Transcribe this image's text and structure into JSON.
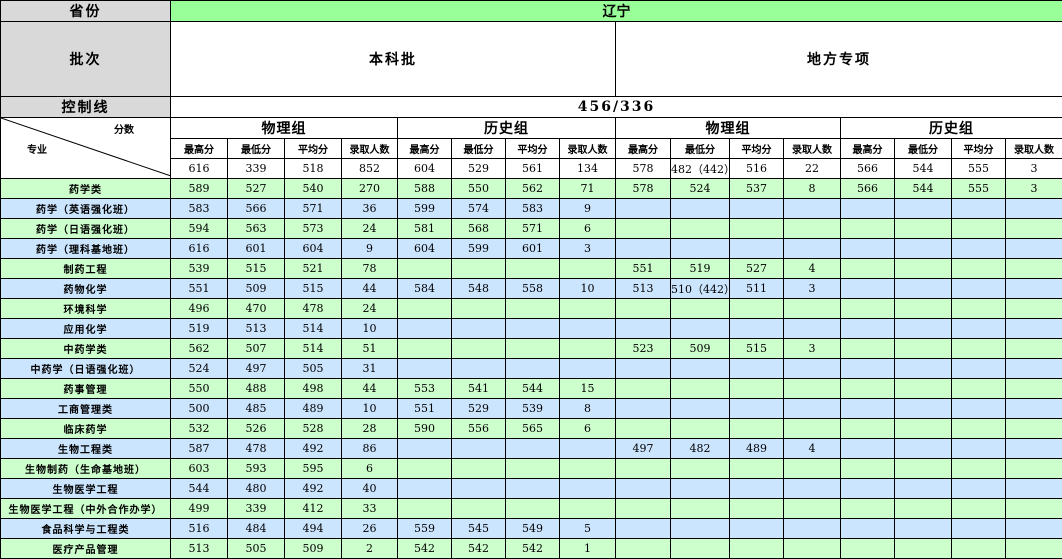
{
  "labels": {
    "province": "省份",
    "batch": "批次",
    "control_line": "控制线",
    "score_header": "分数",
    "major_header": "专业"
  },
  "province_value": "辽宁",
  "batches": [
    "本科批",
    "地方专项"
  ],
  "control_line_value": "456/336",
  "groups": [
    "物理组",
    "历史组",
    "物理组",
    "历史组"
  ],
  "stat_headers": [
    "最高分",
    "最低分",
    "平均分",
    "录取人数"
  ],
  "totals": [
    "616",
    "339",
    "518",
    "852",
    "604",
    "529",
    "561",
    "134",
    "578",
    "482（442）",
    "516",
    "22",
    "566",
    "544",
    "555",
    "3"
  ],
  "rows": [
    {
      "name": "药学类",
      "cells": [
        "589",
        "527",
        "540",
        "270",
        "588",
        "550",
        "562",
        "71",
        "578",
        "524",
        "537",
        "8",
        "566",
        "544",
        "555",
        "3"
      ]
    },
    {
      "name": "药学（英语强化班）",
      "cells": [
        "583",
        "566",
        "571",
        "36",
        "599",
        "574",
        "583",
        "9",
        "",
        "",
        "",
        "",
        "",
        "",
        "",
        ""
      ]
    },
    {
      "name": "药学（日语强化班）",
      "cells": [
        "594",
        "563",
        "573",
        "24",
        "581",
        "568",
        "571",
        "6",
        "",
        "",
        "",
        "",
        "",
        "",
        "",
        ""
      ]
    },
    {
      "name": "药学（理科基地班）",
      "cells": [
        "616",
        "601",
        "604",
        "9",
        "604",
        "599",
        "601",
        "3",
        "",
        "",
        "",
        "",
        "",
        "",
        "",
        ""
      ]
    },
    {
      "name": "制药工程",
      "cells": [
        "539",
        "515",
        "521",
        "78",
        "",
        "",
        "",
        "",
        "551",
        "519",
        "527",
        "4",
        "",
        "",
        "",
        ""
      ]
    },
    {
      "name": "药物化学",
      "cells": [
        "551",
        "509",
        "515",
        "44",
        "584",
        "548",
        "558",
        "10",
        "513",
        "510（442）",
        "511",
        "3",
        "",
        "",
        "",
        ""
      ]
    },
    {
      "name": "环境科学",
      "cells": [
        "496",
        "470",
        "478",
        "24",
        "",
        "",
        "",
        "",
        "",
        "",
        "",
        "",
        "",
        "",
        "",
        ""
      ]
    },
    {
      "name": "应用化学",
      "cells": [
        "519",
        "513",
        "514",
        "10",
        "",
        "",
        "",
        "",
        "",
        "",
        "",
        "",
        "",
        "",
        "",
        ""
      ]
    },
    {
      "name": "中药学类",
      "cells": [
        "562",
        "507",
        "514",
        "51",
        "",
        "",
        "",
        "",
        "523",
        "509",
        "515",
        "3",
        "",
        "",
        "",
        ""
      ]
    },
    {
      "name": "中药学（日语强化班）",
      "cells": [
        "524",
        "497",
        "505",
        "31",
        "",
        "",
        "",
        "",
        "",
        "",
        "",
        "",
        "",
        "",
        "",
        ""
      ]
    },
    {
      "name": "药事管理",
      "cells": [
        "550",
        "488",
        "498",
        "44",
        "553",
        "541",
        "544",
        "15",
        "",
        "",
        "",
        "",
        "",
        "",
        "",
        ""
      ]
    },
    {
      "name": "工商管理类",
      "cells": [
        "500",
        "485",
        "489",
        "10",
        "551",
        "529",
        "539",
        "8",
        "",
        "",
        "",
        "",
        "",
        "",
        "",
        ""
      ]
    },
    {
      "name": "临床药学",
      "cells": [
        "532",
        "526",
        "528",
        "28",
        "590",
        "556",
        "565",
        "6",
        "",
        "",
        "",
        "",
        "",
        "",
        "",
        ""
      ]
    },
    {
      "name": "生物工程类",
      "cells": [
        "587",
        "478",
        "492",
        "86",
        "",
        "",
        "",
        "",
        "497",
        "482",
        "489",
        "4",
        "",
        "",
        "",
        ""
      ]
    },
    {
      "name": "生物制药（生命基地班）",
      "cells": [
        "603",
        "593",
        "595",
        "6",
        "",
        "",
        "",
        "",
        "",
        "",
        "",
        "",
        "",
        "",
        "",
        ""
      ]
    },
    {
      "name": "生物医学工程",
      "cells": [
        "544",
        "480",
        "492",
        "40",
        "",
        "",
        "",
        "",
        "",
        "",
        "",
        "",
        "",
        "",
        "",
        ""
      ]
    },
    {
      "name": "生物医学工程（中外合作办学）",
      "cells": [
        "499",
        "339",
        "412",
        "33",
        "",
        "",
        "",
        "",
        "",
        "",
        "",
        "",
        "",
        "",
        "",
        ""
      ]
    },
    {
      "name": "食品科学与工程类",
      "cells": [
        "516",
        "484",
        "494",
        "26",
        "559",
        "545",
        "549",
        "5",
        "",
        "",
        "",
        "",
        "",
        "",
        "",
        ""
      ]
    },
    {
      "name": "医疗产品管理",
      "cells": [
        "513",
        "505",
        "509",
        "2",
        "542",
        "542",
        "542",
        "1",
        "",
        "",
        "",
        "",
        "",
        "",
        "",
        ""
      ]
    }
  ],
  "colors": {
    "header_gray": "#d9d9d9",
    "province_green": "#99ff99",
    "row_green": "#ccffcc",
    "row_blue": "#cce5ff"
  }
}
